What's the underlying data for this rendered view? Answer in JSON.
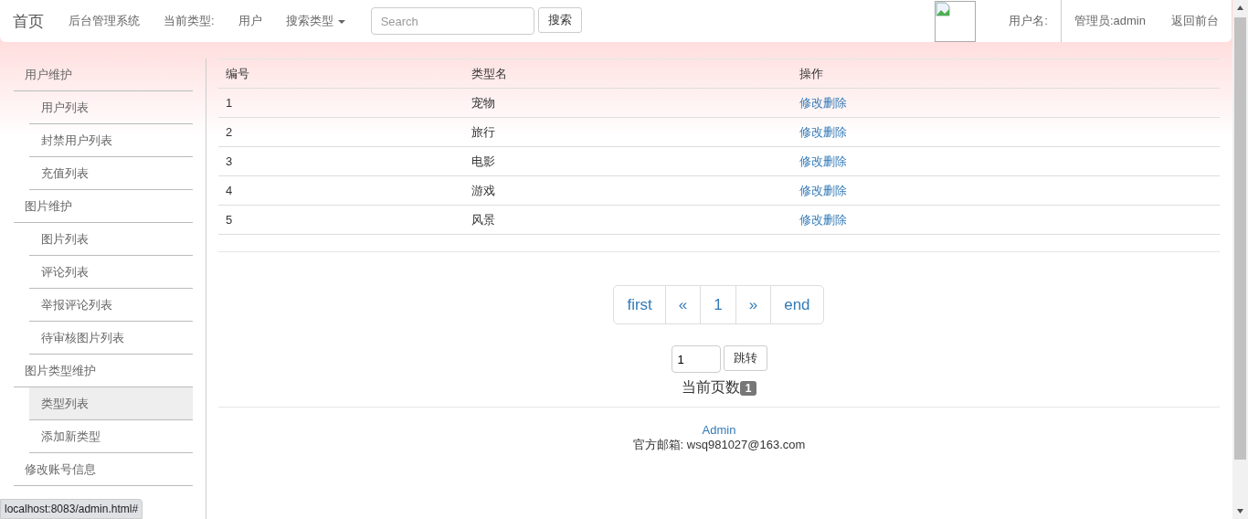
{
  "navbar": {
    "brand": "首页",
    "items": [
      {
        "kind": "link",
        "label": "后台管理系统"
      },
      {
        "kind": "text",
        "label": "当前类型:"
      },
      {
        "kind": "link",
        "label": "用户"
      },
      {
        "kind": "dropdown",
        "label": "搜索类型"
      }
    ],
    "search": {
      "placeholder": "Search",
      "button": "搜索"
    },
    "right": [
      {
        "kind": "avatar"
      },
      {
        "kind": "text",
        "label": "用户名:"
      },
      {
        "kind": "link",
        "label": "管理员:admin"
      },
      {
        "kind": "link",
        "label": "返回前台"
      }
    ]
  },
  "sidebar": [
    {
      "label": "用户维护",
      "selected": false,
      "children": [
        {
          "label": "用户列表",
          "selected": false
        },
        {
          "label": "封禁用户列表",
          "selected": false
        },
        {
          "label": "充值列表",
          "selected": false
        }
      ]
    },
    {
      "label": "图片维护",
      "selected": false,
      "children": [
        {
          "label": "图片列表",
          "selected": false
        },
        {
          "label": "评论列表",
          "selected": false
        },
        {
          "label": "举报评论列表",
          "selected": false
        },
        {
          "label": "待审核图片列表",
          "selected": false
        }
      ]
    },
    {
      "label": "图片类型维护",
      "selected": false,
      "children": [
        {
          "label": "类型列表",
          "selected": true
        },
        {
          "label": "添加新类型",
          "selected": false
        }
      ]
    },
    {
      "label": "修改账号信息",
      "selected": false
    }
  ],
  "table": {
    "columns": [
      "编号",
      "类型名",
      "操作"
    ],
    "rows": [
      {
        "id": "1",
        "name": "宠物",
        "edit": "修改",
        "del": "删除"
      },
      {
        "id": "2",
        "name": "旅行",
        "edit": "修改",
        "del": "删除"
      },
      {
        "id": "3",
        "name": "电影",
        "edit": "修改",
        "del": "删除"
      },
      {
        "id": "4",
        "name": "游戏",
        "edit": "修改",
        "del": "删除"
      },
      {
        "id": "5",
        "name": "风景",
        "edit": "修改",
        "del": "删除"
      }
    ]
  },
  "pagination": {
    "links": [
      "first",
      "«",
      "1",
      "»",
      "end"
    ],
    "jump_value": "1",
    "jump_button": "跳转",
    "current_label": "当前页数",
    "current_page": "1"
  },
  "footer": {
    "link": "Admin",
    "email": "官方邮箱: wsq981027@163.com"
  },
  "status_bar": "localhost:8083/admin.html#"
}
